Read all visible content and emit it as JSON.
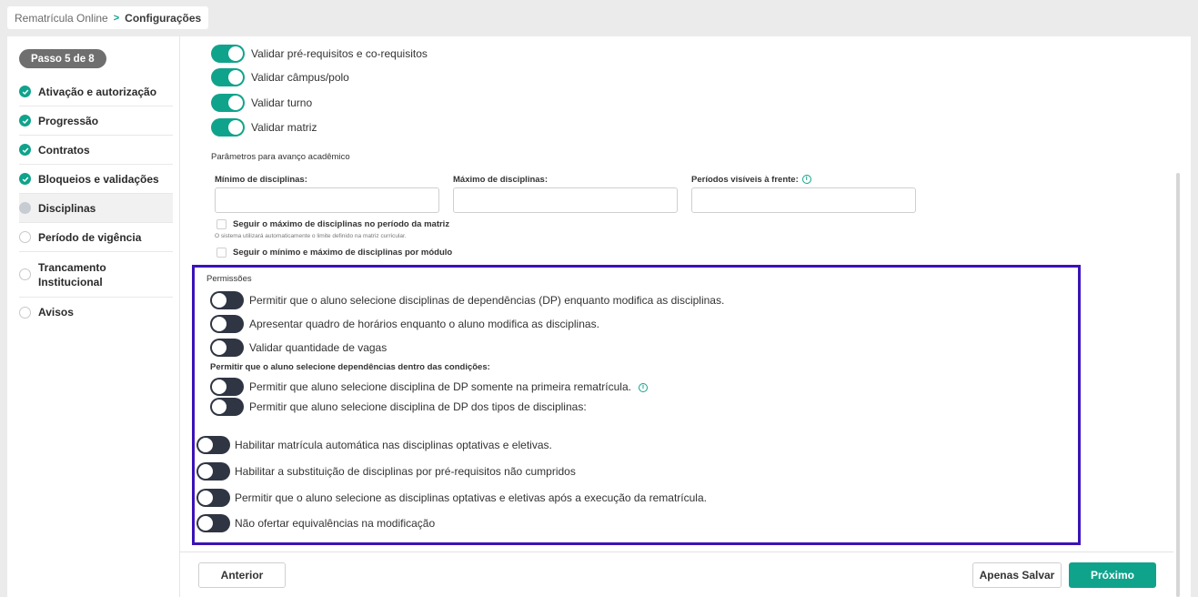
{
  "breadcrumb": {
    "root": "Rematrícula Online",
    "separator": ">",
    "current": "Configurações"
  },
  "sidebar": {
    "step_badge": "Passo 5 de 8",
    "items": [
      {
        "label": "Ativação e autorização",
        "status": "done"
      },
      {
        "label": "Progressão",
        "status": "done"
      },
      {
        "label": "Contratos",
        "status": "done"
      },
      {
        "label": "Bloqueios e validações",
        "status": "done"
      },
      {
        "label": "Disciplinas",
        "status": "current"
      },
      {
        "label": "Período de vigência",
        "status": "pending"
      },
      {
        "label": "Trancamento Institucional",
        "status": "pending"
      },
      {
        "label": "Avisos",
        "status": "pending"
      }
    ]
  },
  "validations": [
    {
      "label": "Validar pré-requisitos e co-requisitos",
      "on": true
    },
    {
      "label": "Validar câmpus/polo",
      "on": true
    },
    {
      "label": "Validar turno",
      "on": true
    },
    {
      "label": "Validar matriz",
      "on": true
    }
  ],
  "academic": {
    "title": "Parâmetros para avanço acadêmico",
    "min_label": "Mínimo de disciplinas:",
    "max_label": "Máximo de disciplinas:",
    "periods_label": "Períodos visíveis à frente:",
    "min_value": "",
    "max_value": "",
    "periods_value": "",
    "check_max_label": "Seguir o máximo de disciplinas no período da matriz",
    "check_max_hint": "O sistema utilizará automaticamente o limite definido na matriz curricular.",
    "check_module_label": "Seguir o mínimo e máximo de disciplinas por módulo"
  },
  "permissions": {
    "title": "Permissões",
    "toggles": [
      {
        "label": "Permitir que o aluno selecione disciplinas de dependências (DP) enquanto modifica as disciplinas.",
        "on": false
      },
      {
        "label": "Apresentar quadro de horários enquanto o aluno modifica as disciplinas.",
        "on": false
      },
      {
        "label": "Validar quantidade de vagas",
        "on": false
      }
    ],
    "dp_subtitle": "Permitir que o aluno selecione dependências dentro das condições:",
    "dp_toggles": [
      {
        "label": "Permitir que aluno selecione disciplina de DP somente na primeira rematrícula.",
        "on": false
      },
      {
        "label": "Permitir que aluno selecione disciplina de DP dos tipos de disciplinas:",
        "on": false
      }
    ],
    "extra_toggles": [
      {
        "label": "Habilitar matrícula automática nas disciplinas optativas e eletivas.",
        "on": false
      },
      {
        "label": "Habilitar a substituição de disciplinas por pré-requisitos não cumpridos",
        "on": false
      },
      {
        "label": "Permitir que o aluno selecione as disciplinas optativas e eletivas após a execução da rematrícula.",
        "on": false
      },
      {
        "label": "Não ofertar equivalências na modificação",
        "on": false
      }
    ]
  },
  "footer": {
    "prev_label": "Anterior",
    "save_label": "Apenas Salvar",
    "next_label": "Próximo"
  },
  "colors": {
    "accent": "#10a38c",
    "highlight_border": "#3b13b8",
    "toggle_off": "#2f3542"
  }
}
